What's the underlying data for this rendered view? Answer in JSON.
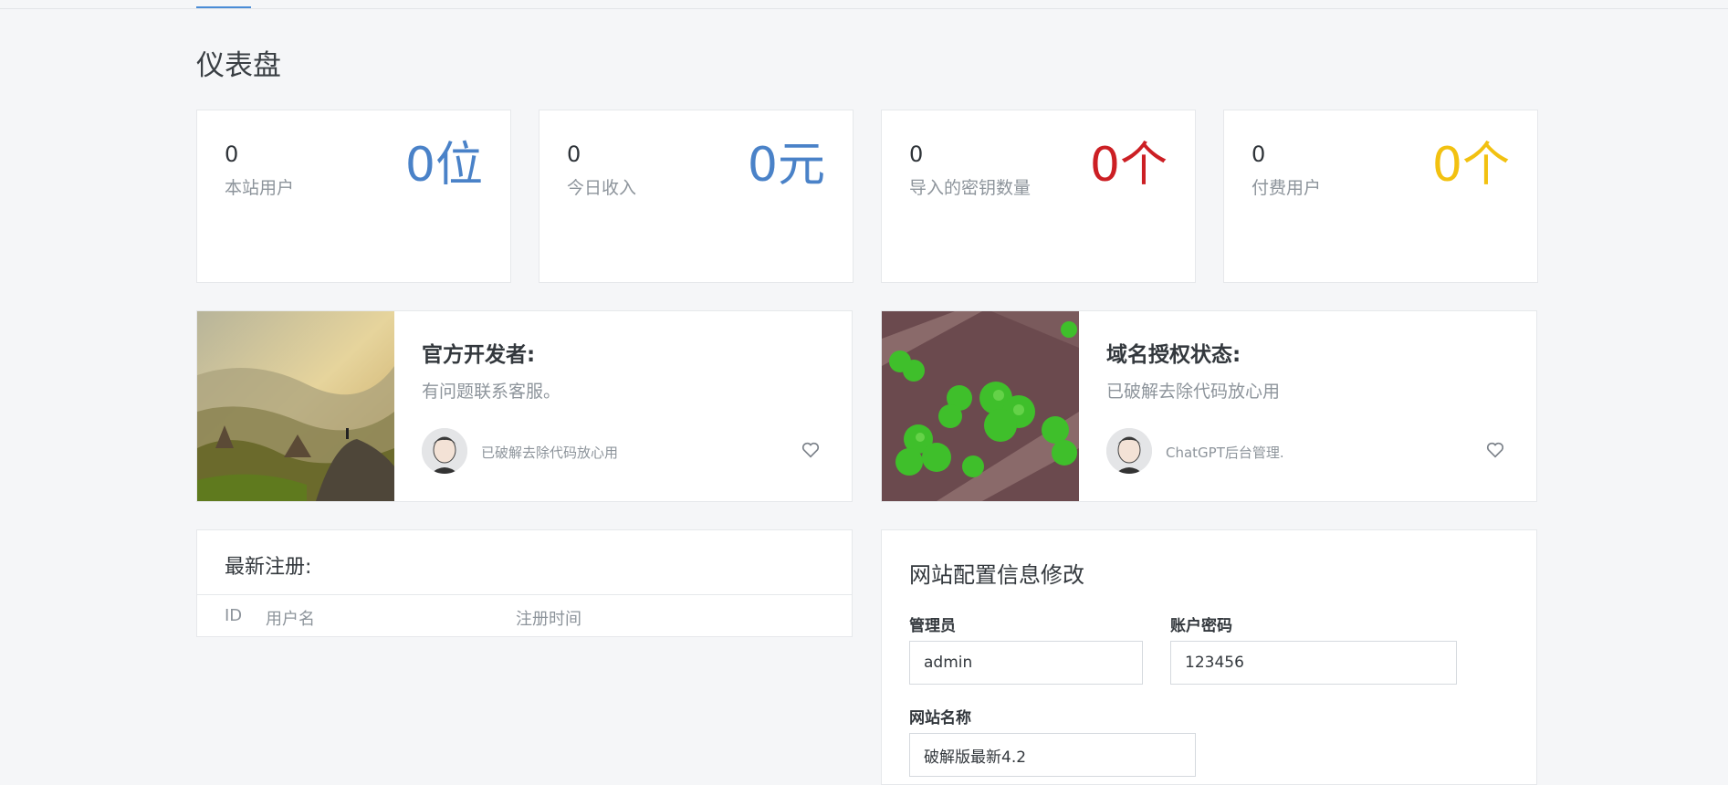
{
  "page": {
    "title": "仪表盘"
  },
  "stats": [
    {
      "value": "0",
      "label": "本站用户",
      "big": "0位",
      "color": "#4a82c8"
    },
    {
      "value": "0",
      "label": "今日收入",
      "big": "0元",
      "color": "#4a82c8"
    },
    {
      "value": "0",
      "label": "导入的密钥数量",
      "big": "0个",
      "color": "#cc1f24"
    },
    {
      "value": "0",
      "label": "付费用户",
      "big": "0个",
      "color": "#f2c110"
    }
  ],
  "info_cards": [
    {
      "title": "官方开发者:",
      "desc": "有问题联系客服。",
      "author": "已破解去除代码放心用",
      "image": "mountain-landscape-photo",
      "icon": "heart-icon"
    },
    {
      "title": "域名授权状态:",
      "desc": "已破解去除代码放心用",
      "author": "ChatGPT后台管理.",
      "image": "clover-leaves-photo",
      "icon": "heart-icon"
    }
  ],
  "registrations": {
    "title": "最新注册:",
    "columns": [
      "ID",
      "用户名",
      "注册时间"
    ]
  },
  "config": {
    "title": "网站配置信息修改",
    "fields": [
      {
        "label": "管理员",
        "value": "admin"
      },
      {
        "label": "账户密码",
        "value": "123456"
      },
      {
        "label": "网站名称",
        "value": "破解版最新4.2"
      }
    ]
  }
}
